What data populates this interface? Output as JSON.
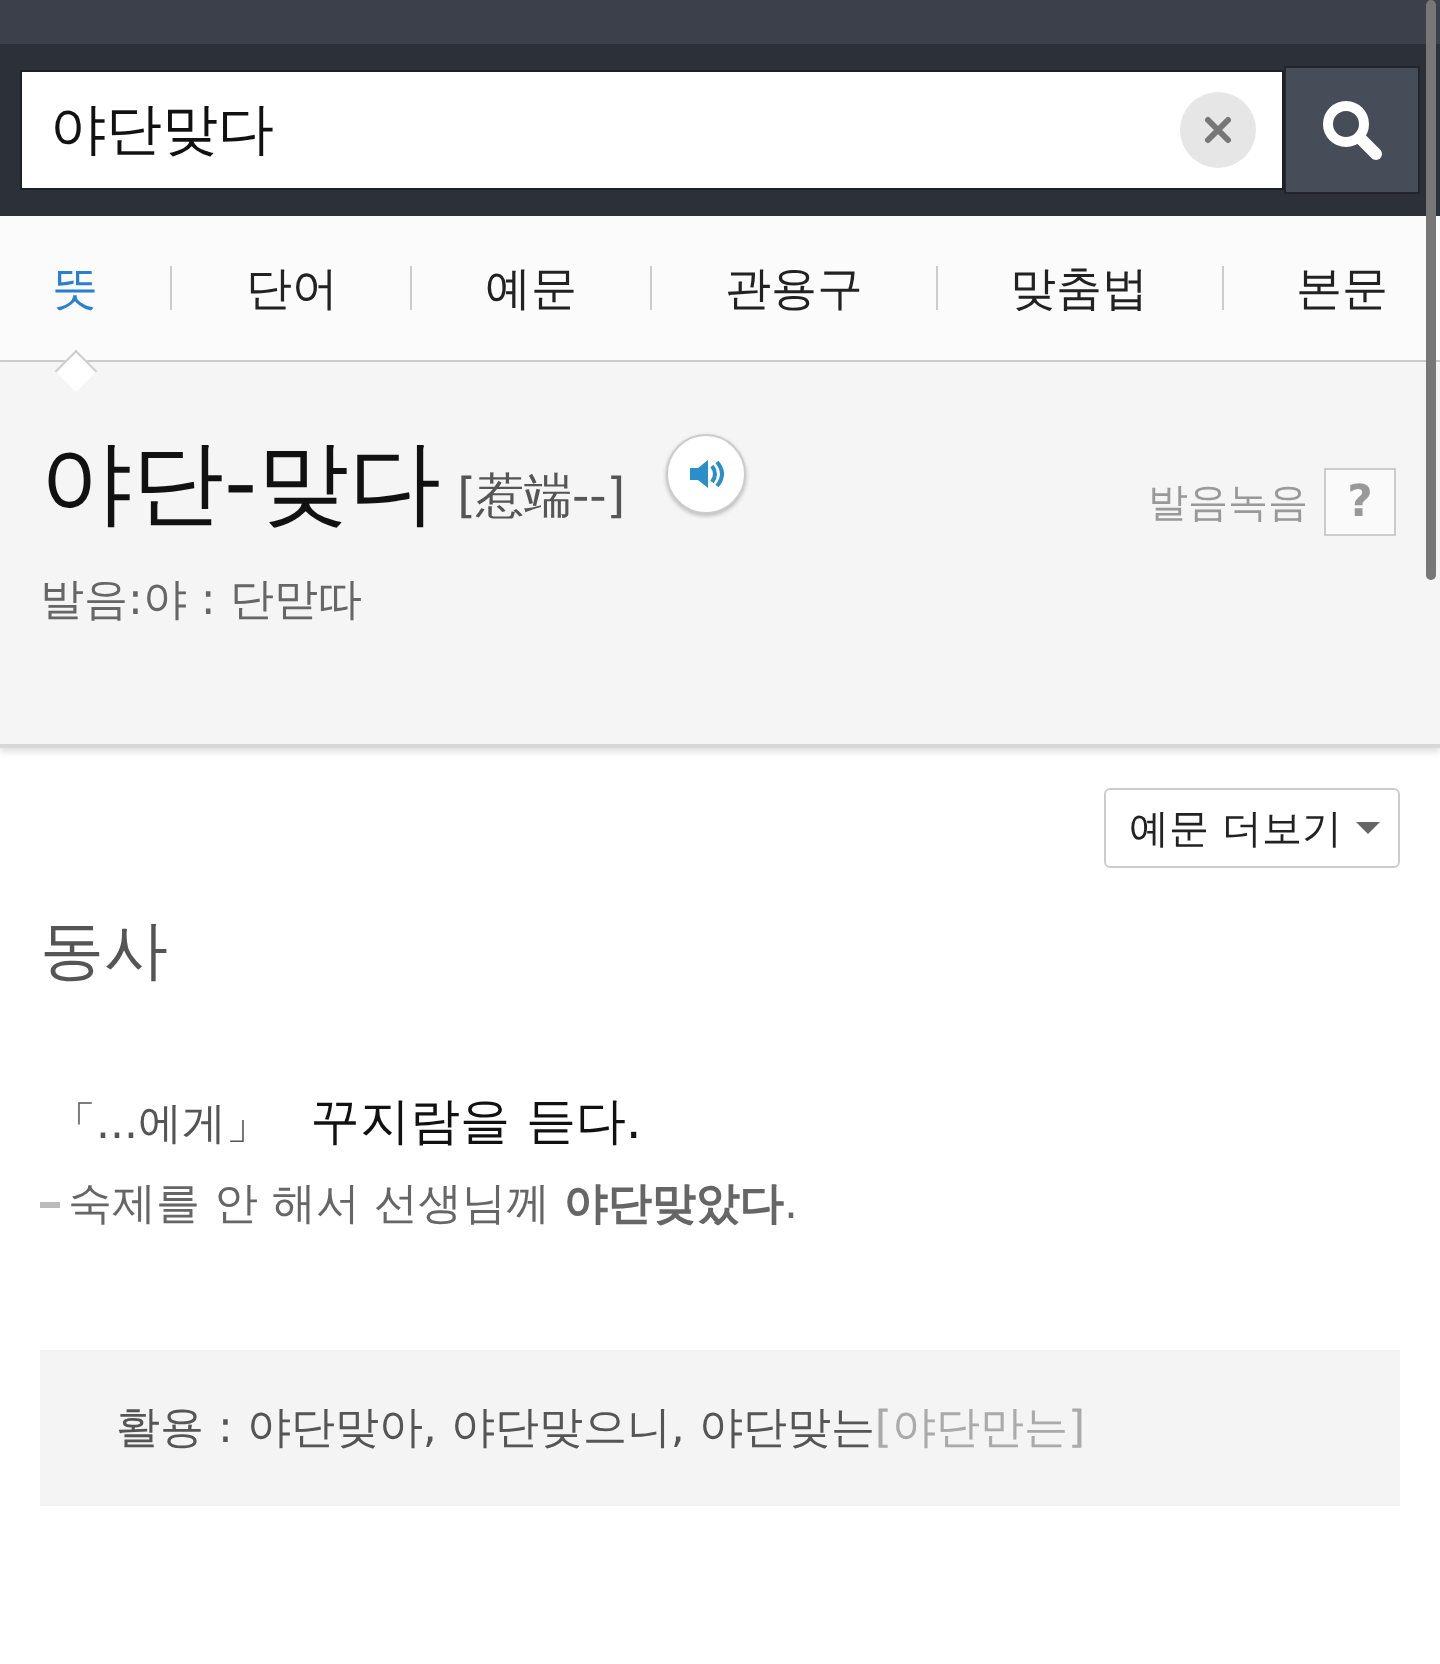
{
  "search": {
    "value": "야단맞다"
  },
  "tabs": [
    {
      "label": "뜻",
      "selected": true
    },
    {
      "label": "단어",
      "selected": false
    },
    {
      "label": "예문",
      "selected": false
    },
    {
      "label": "관용구",
      "selected": false
    },
    {
      "label": "맞춤법",
      "selected": false
    },
    {
      "label": "본문",
      "selected": false
    }
  ],
  "entry": {
    "headword": "야단-맞다",
    "hanja": "[惹端--]",
    "record_label": "발음녹음",
    "help": "?",
    "pronunciation": "발음:야 : 단맏따"
  },
  "more_examples": "예문 더보기",
  "pos": "동사",
  "sense": {
    "pattern": "「...에게」",
    "definition": "꾸지람을 듣다.",
    "example": "숙제를 안 해서 선생님께 **야단맞았다**."
  },
  "conjugation": {
    "text": "활용 : 야단맞아, 야단맞으니, 야단맞는",
    "variant": "[야단만는]"
  }
}
